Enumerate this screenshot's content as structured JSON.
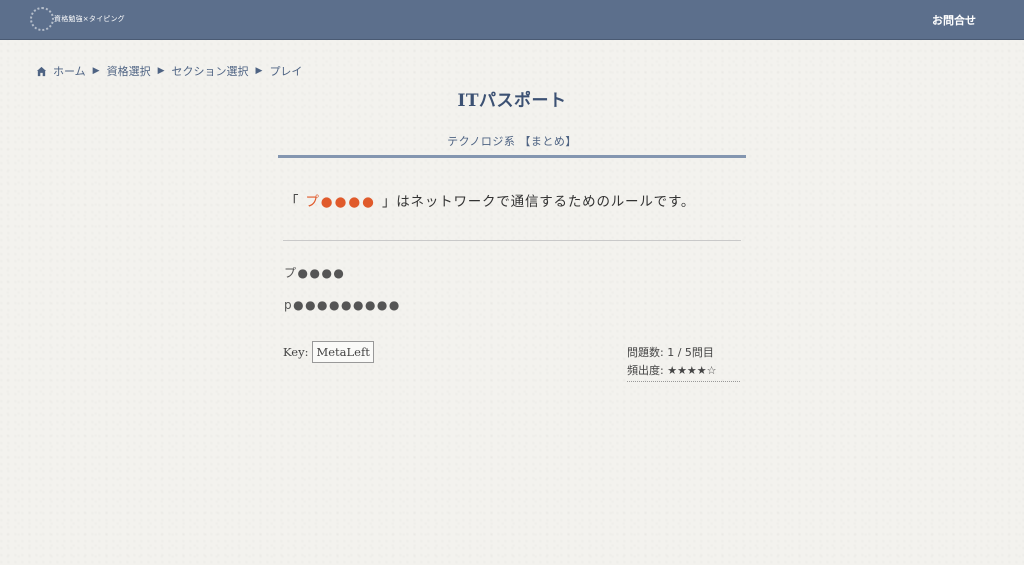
{
  "header": {
    "logo_text": "資格勉強×タイピング",
    "contact_label": "お問合せ"
  },
  "breadcrumb": {
    "items": [
      "ホーム",
      "資格選択",
      "セクション選択",
      "プレイ"
    ],
    "separator": "▶"
  },
  "page": {
    "title": "ITパスポート",
    "section": "テクノロジ系 【まとめ】"
  },
  "question": {
    "open_bracket": "「",
    "answer_masked": "プ●●●●",
    "close_bracket": "」",
    "text_after": "はネットワークで通信するためのルールです。",
    "answer_color": "#e05a2b"
  },
  "hints": {
    "kana": "プ●●●●",
    "romaji": "p●●●●●●●●●"
  },
  "key": {
    "label": "Key:",
    "value": "MetaLeft"
  },
  "stats": {
    "question_count": "問題数: 1 / 5問目",
    "frequency": "頻出度: ★★★★☆"
  },
  "colors": {
    "header_bg": "#5c6f8c",
    "accent": "#3c5173"
  }
}
